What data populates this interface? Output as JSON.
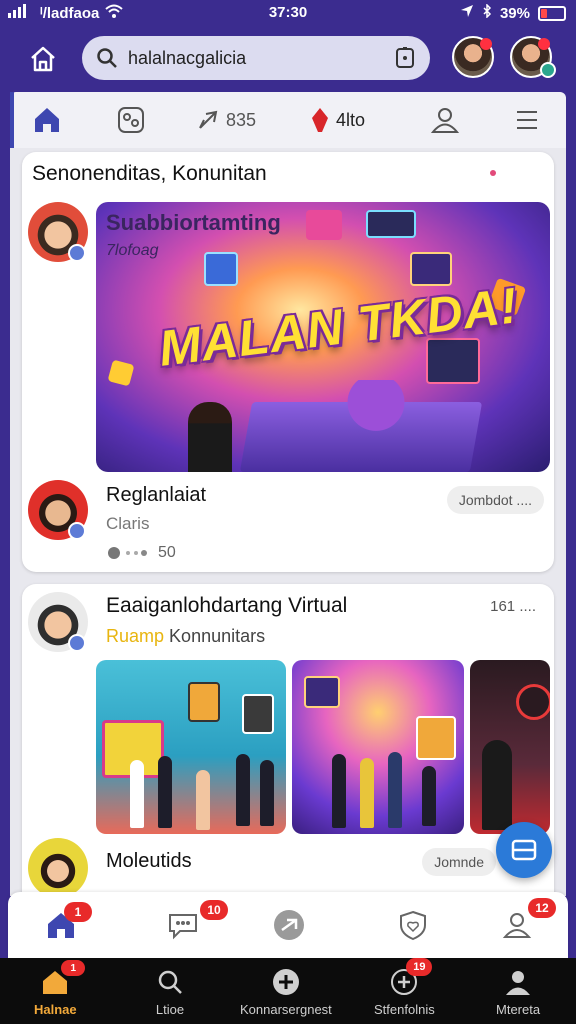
{
  "status": {
    "carrier": "ᴵ/ladfaoa",
    "time": "37:30",
    "battery": "39%"
  },
  "search": {
    "value": "halalnacgalicia"
  },
  "nav": {
    "item3_label": "835",
    "item4_label": "4lto"
  },
  "feed": {
    "card1": {
      "title": "Senonenditas, Konunitan",
      "banner_title": "Suabbiortamting",
      "banner_sub": "7lofoag",
      "banner_headline": "MALAN TKDA!",
      "author_name": "Reglanlaiat",
      "author_sub": "Claris",
      "stats": "50",
      "pill": "Jombdot ...."
    },
    "card2": {
      "title": "Eaaiganlohdartang Virtual",
      "sub_highlight": "Ruamp",
      "sub_rest": "Konnunitars",
      "count": "161 ....",
      "bottom_title": "Moleutids",
      "pill": "Jomnde"
    }
  },
  "bottom_nav": {
    "badges": [
      "1",
      "10",
      "12"
    ]
  },
  "tabs": [
    {
      "label": "Halnae",
      "badge": "1"
    },
    {
      "label": "Ltioe"
    },
    {
      "label": "Konnarsergnest"
    },
    {
      "label": "Stfenfolnis",
      "badge": "19"
    },
    {
      "label": "Mtereta"
    }
  ],
  "colors": {
    "header_bg": "#3b2c8f",
    "accent": "#3e47b0",
    "badge_red": "#e82a2a",
    "fab_blue": "#2b7ad8",
    "tab_active": "#f2a93a"
  }
}
